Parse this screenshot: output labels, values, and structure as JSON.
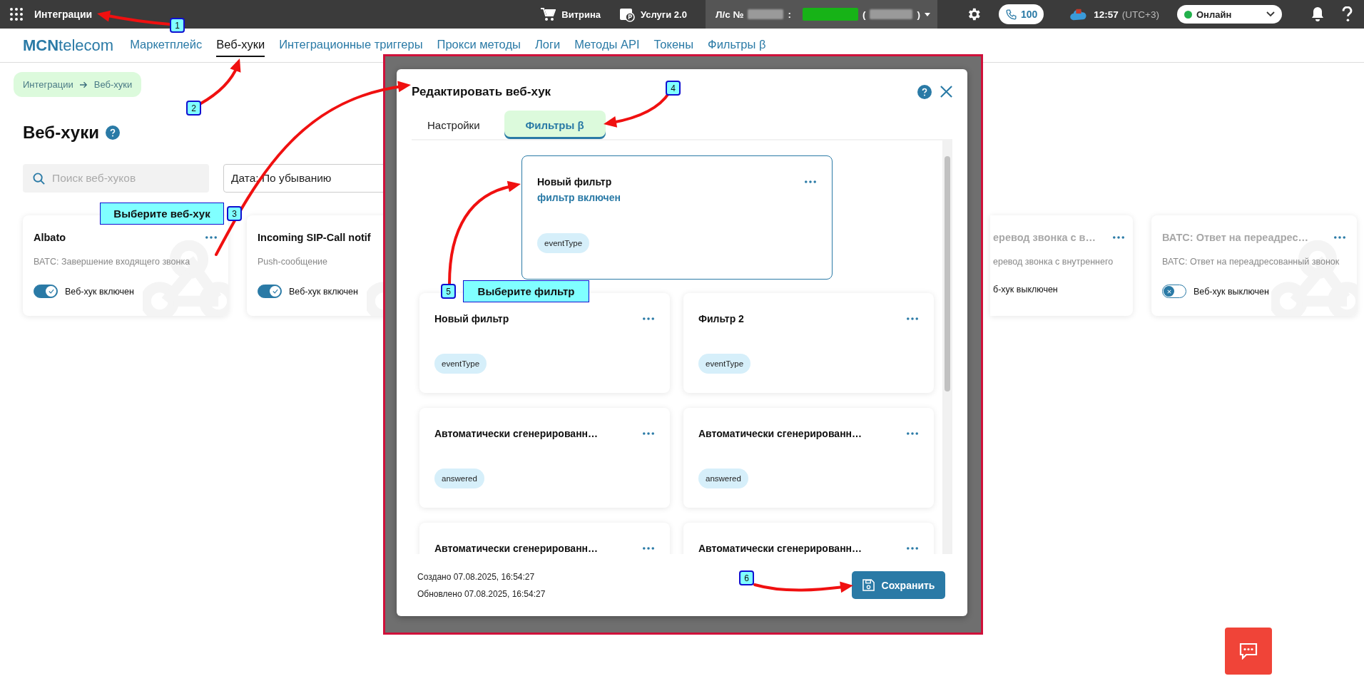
{
  "topbar": {
    "app_title": "Интеграции",
    "links": [
      {
        "label": "Витрина",
        "kind": "cart"
      },
      {
        "label": "Услуги 2.0",
        "kind": "services"
      }
    ],
    "account": {
      "label": "Л/с №",
      "separator": ":",
      "open": "(",
      "close": ")"
    },
    "calls": "100",
    "time": "12:57",
    "timezone": "(UTC+3)",
    "status": "Онлайн"
  },
  "nav": {
    "logo": "**MCN**telecom",
    "items": [
      {
        "label": "Маркетплейс",
        "selected": false
      },
      {
        "label": "Веб-хуки",
        "selected": true
      },
      {
        "label": "Интеграционные триггеры",
        "selected": false
      },
      {
        "label": "Прокси методы",
        "selected": false
      },
      {
        "label": "Логи",
        "selected": false
      },
      {
        "label": "Методы API",
        "selected": false
      },
      {
        "label": "Токены",
        "selected": false
      },
      {
        "label": "Фильтры β",
        "selected": false
      }
    ]
  },
  "breadcrumb": [
    "Интеграции",
    "Веб-хуки"
  ],
  "heading": "Веб-хуки",
  "search": {
    "placeholder": "Поиск веб-хуков"
  },
  "sort": {
    "value": "Дата: По убыванию"
  },
  "webhooks": [
    {
      "title": "Albato",
      "event": "ВАТС: Завершение входящего звонка",
      "enabled": true,
      "toggle_label": "Веб-хук включен"
    },
    {
      "title": "Incoming SIP-Call notif",
      "event": "Push-сообщение",
      "enabled": true,
      "toggle_label": "Веб-хук включен"
    },
    {
      "title": "еревод звонка с в…",
      "event": "еревод звонка с внутреннего",
      "enabled": false,
      "toggle_label": "б-хук выключен",
      "clipped": true
    },
    {
      "title": "ВАТС: Ответ на переадрес…",
      "event": "ВАТС: Ответ на переадресованный звонок",
      "enabled": false,
      "toggle_label": "Веб-хук выключен"
    }
  ],
  "modal": {
    "title": "Редактировать веб-хук",
    "tabs": [
      {
        "label": "Настройки",
        "selected": false
      },
      {
        "label": "Фильтры β",
        "selected": true
      }
    ],
    "highlighted_filter": {
      "title": "Новый фильтр",
      "status": "фильтр включен",
      "tags": [
        "eventType"
      ]
    },
    "filters": [
      {
        "title": "Новый фильтр",
        "tags": [
          "eventType"
        ]
      },
      {
        "title": "Фильтр 2",
        "tags": [
          "eventType"
        ]
      },
      {
        "title": "Автоматически сгенерированн…",
        "tags": [
          "answered"
        ]
      },
      {
        "title": "Автоматически сгенерированн…",
        "tags": [
          "answered"
        ]
      },
      {
        "title": "Автоматически сгенерированн…"
      },
      {
        "title": "Автоматически сгенерированн…"
      }
    ],
    "created": "Создано 07.08.2025, 16:54:27",
    "updated": "Обновлено 07.08.2025, 16:54:27",
    "save_button": "Сохранить"
  },
  "annotations": {
    "steps": [
      "1",
      "2",
      "3",
      "4",
      "5",
      "6"
    ],
    "callouts": [
      "Выберите веб-хук",
      "Выберите фильтр"
    ]
  }
}
